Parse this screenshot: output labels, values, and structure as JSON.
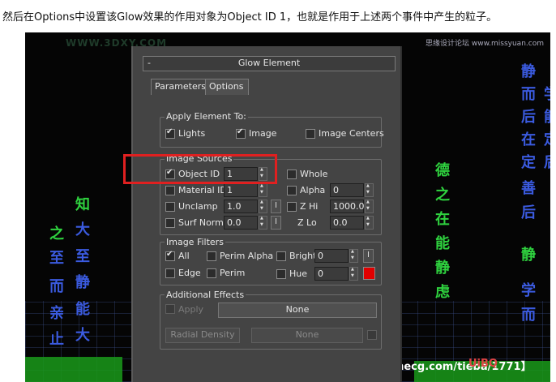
{
  "caption": "然后在Options中设置该Glow效果的作用对象为Object ID 1，也就是作用于上述两个事件中产生的粒子。",
  "scene": {
    "watermark_top": "WWW.3DXY.COM",
    "watermark_right": "思缘设计论坛 www.missyuan.com",
    "left_blue_column_1": [
      "之",
      "至",
      "而",
      "亲",
      "止"
    ],
    "left_blue_column_2": [
      "知",
      "大",
      "至",
      "静",
      "能",
      "大"
    ],
    "left_green_top": "之",
    "mid_green_column": [
      "德",
      "之",
      "在",
      "能",
      "静",
      "虑"
    ],
    "right_blue_column_1": [
      "静",
      "而",
      "后",
      "在",
      "定",
      "善",
      "后"
    ],
    "right_blue_column_2": [
      "学",
      "能",
      "定",
      "后",
      "静",
      "学",
      "而"
    ],
    "footer_credit": "3Dmax吧 【www.linecg.com/tieba/1771】",
    "footer_logo": "UiBQ"
  },
  "panel": {
    "collapse_symbol": "-",
    "title": "Glow Element",
    "tabs": [
      {
        "label": "Parameters",
        "active": false
      },
      {
        "label": "Options",
        "active": true
      }
    ],
    "apply_element": {
      "title": "Apply Element To:",
      "lights": "Lights",
      "image": "Image",
      "image_centers": "Image Centers"
    },
    "image_sources": {
      "title": "Image Sources",
      "object_id_label": "Object ID",
      "object_id_value": "1",
      "whole_label": "Whole",
      "material_id_label": "Material ID",
      "material_id_value": "1",
      "alpha_label": "Alpha",
      "alpha_value": "0",
      "unclamp_label": "Unclamp",
      "unclamp_value": "1.0",
      "zhi_label": "Z Hi",
      "zhi_value": "1000.0",
      "surf_norm_label": "Surf Norm",
      "surf_norm_value": "0.0",
      "zlo_label": "Z Lo",
      "zlo_value": "0.0",
      "i_button": "I"
    },
    "image_filters": {
      "title": "Image Filters",
      "all_label": "All",
      "perim_alpha_label": "Perim Alpha",
      "bright_label": "Bright",
      "bright_value": "0",
      "edge_label": "Edge",
      "perim_label": "Perim",
      "hue_label": "Hue",
      "hue_value": "0",
      "hue_color": "#e00000",
      "i_button": "I"
    },
    "additional_effects": {
      "title": "Additional Effects",
      "apply_label": "Apply",
      "none_button_1": "None",
      "radial_density_button": "Radial Density",
      "none_button_2": "None"
    }
  },
  "colors": {
    "highlight": "#e02020",
    "panel_bg": "#444444"
  }
}
